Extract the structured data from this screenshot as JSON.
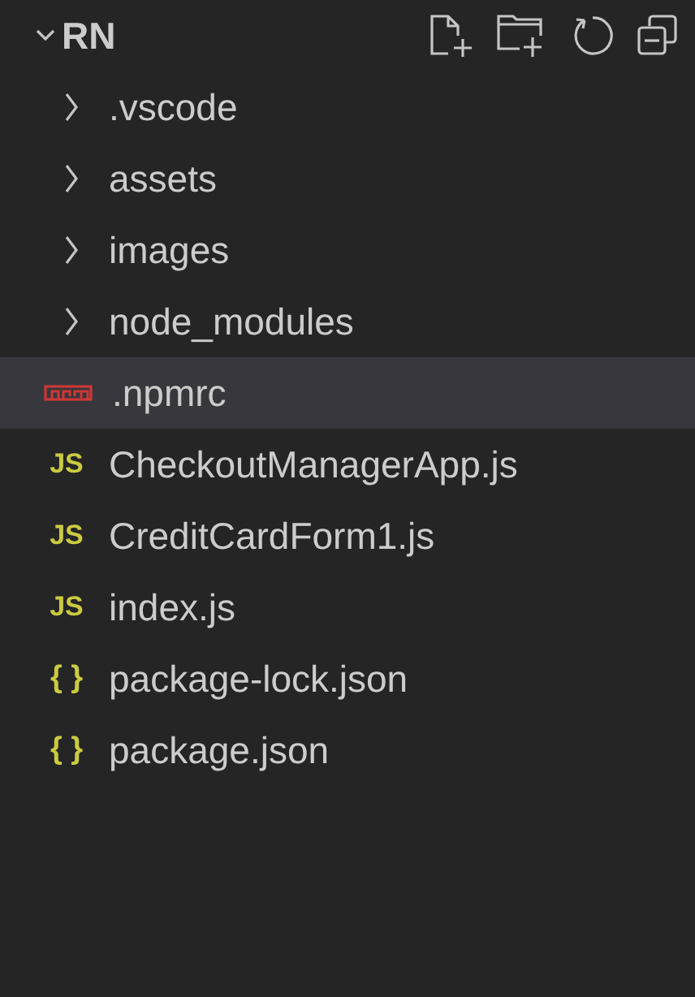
{
  "explorer": {
    "title": "RN",
    "expanded": true,
    "items": [
      {
        "kind": "folder",
        "name": ".vscode",
        "expanded": false,
        "selected": false
      },
      {
        "kind": "folder",
        "name": "assets",
        "expanded": false,
        "selected": false
      },
      {
        "kind": "folder",
        "name": "images",
        "expanded": false,
        "selected": false
      },
      {
        "kind": "folder",
        "name": "node_modules",
        "expanded": false,
        "selected": false
      },
      {
        "kind": "npm",
        "name": ".npmrc",
        "selected": true
      },
      {
        "kind": "js",
        "icon_glyph": "JS",
        "name": "CheckoutManagerApp.js",
        "selected": false
      },
      {
        "kind": "js",
        "icon_glyph": "JS",
        "name": "CreditCardForm1.js",
        "selected": false
      },
      {
        "kind": "js",
        "icon_glyph": "JS",
        "name": "index.js",
        "selected": false
      },
      {
        "kind": "json",
        "icon_glyph": "{ }",
        "name": "package-lock.json",
        "selected": false
      },
      {
        "kind": "json",
        "icon_glyph": "{ }",
        "name": "package.json",
        "selected": false
      }
    ]
  }
}
